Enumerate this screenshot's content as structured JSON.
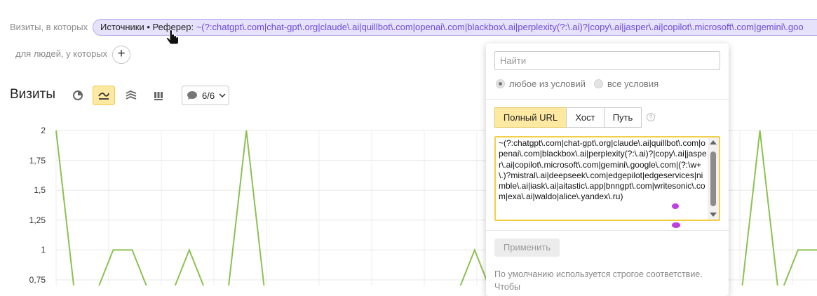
{
  "filter": {
    "visits_label": "Визиты, в которых",
    "pill_key": "Источники • Реферер:",
    "pill_value": "~(?:chatgpt\\.com|chat-gpt\\.org|claude\\.ai|quillbot\\.com|openai\\.com|blackbox\\.ai|perplexity(?:\\.ai)?|copy\\.ai|jasper\\.ai|copilot\\.microsoft\\.com|gemini\\.goo",
    "people_label": "для людей, у которых",
    "add_symbol": "+"
  },
  "toolbar": {
    "title": "Визиты",
    "icons": [
      "pie-chart-icon",
      "line-chart-icon",
      "stacked-area-icon",
      "bar-chart-icon"
    ],
    "active_icon": "line-chart-icon",
    "series_count": "6/6"
  },
  "popup": {
    "search_placeholder": "Найти",
    "radio_any": "любое из условий",
    "radio_all": "все условия",
    "radio_selected": "any",
    "seg_full_url": "Полный URL",
    "seg_host": "Хост",
    "seg_path": "Путь",
    "seg_selected": "full_url",
    "help": "?",
    "regex_value": "~(?:chatgpt\\.com|chat-gpt\\.org|claude\\.ai|quillbot\\.com|openai\\.com|blackbox\\.ai|perplexity(?:\\.ai)?|copy\\.ai|jasper\\.ai|copilot\\.microsoft\\.com|gemini\\.google\\.com|(?:\\w+\\.)?mistral\\.ai|deepseek\\.com|edgepilot|edgeservices|nimble\\.ai|iask\\.ai|aitastic\\.app|bnngpt\\.com|writesonic\\.com|exa\\.ai|waldo|alice\\.yandex\\.ru)",
    "apply_label": "Применить",
    "note": "По умолчанию используется строгое соответствие.",
    "note2": "Чтобы"
  },
  "chart_data": {
    "type": "line",
    "title": "Визиты",
    "y_ticks": [
      "2",
      "1,75",
      "1,5",
      "1,25",
      "1",
      "0,75"
    ],
    "ylim": [
      0.75,
      2
    ],
    "grid": true,
    "series": [
      {
        "color": "#8cc152",
        "points": [
          [
            0,
            2
          ],
          [
            1,
            0.6
          ],
          [
            2,
            0.6
          ],
          [
            3,
            1
          ],
          [
            4,
            1
          ],
          [
            5,
            0.6
          ],
          [
            6,
            0.6
          ],
          [
            7,
            1
          ],
          [
            8,
            0.6
          ],
          [
            9,
            0.6
          ],
          [
            10,
            2
          ],
          [
            11,
            0.6
          ],
          [
            12,
            0.6
          ],
          [
            13,
            0.6
          ],
          [
            14,
            0.6
          ],
          [
            15,
            0.6
          ],
          [
            16,
            0.6
          ],
          [
            17,
            0.6
          ],
          [
            18,
            0.6
          ],
          [
            19,
            0.6
          ],
          [
            20,
            0.6
          ],
          [
            21,
            0.6
          ],
          [
            22,
            1
          ],
          [
            23,
            0.6
          ],
          [
            24,
            1
          ],
          [
            25,
            0.6
          ],
          [
            26,
            0.6
          ],
          [
            27,
            0.6
          ],
          [
            28,
            0.6
          ],
          [
            29,
            0.6
          ],
          [
            30,
            0.6
          ],
          [
            31,
            0.6
          ],
          [
            32,
            0.6
          ],
          [
            33,
            0.6
          ],
          [
            34,
            0.6
          ],
          [
            35,
            0.6
          ],
          [
            36,
            0.6
          ],
          [
            37,
            2
          ],
          [
            38,
            0.6
          ],
          [
            39,
            1
          ],
          [
            40,
            1
          ]
        ]
      }
    ]
  }
}
